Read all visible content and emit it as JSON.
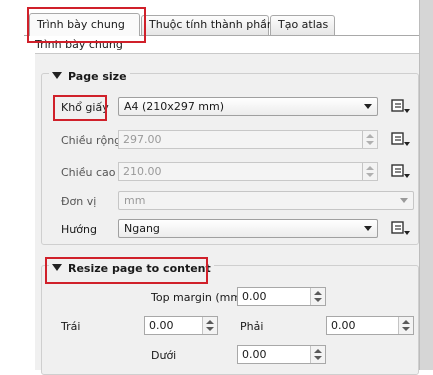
{
  "tabs": [
    {
      "label": "Trình bày chung"
    },
    {
      "label": "Thuộc tính thành phần"
    },
    {
      "label": "Tạo atlas"
    }
  ],
  "panel_title": "Trình bày chung",
  "page_size": {
    "title": "Page size",
    "paper_label": "Khổ giấy",
    "paper_value": "A4 (210x297 mm)",
    "width_label": "Chiều rộng",
    "width_value": "297.00",
    "height_label": "Chiều cao",
    "height_value": "210.00",
    "unit_label": "Đơn vị",
    "unit_value": "mm",
    "orientation_label": "Hướng",
    "orientation_value": "Ngang"
  },
  "resize": {
    "title": "Resize page to content",
    "top_label": "Top margin (mm)",
    "top_value": "0.00",
    "left_label": "Trái",
    "left_value": "0.00",
    "right_label": "Phải",
    "right_value": "0.00",
    "bottom_label": "Dưới",
    "bottom_value": "0.00"
  },
  "colors": {
    "annotation": "#d0202a",
    "panel": "#f0f0f0"
  },
  "icons": {
    "data_defined": "data-defined-override-icon",
    "collapse": "collapse-triangle-icon"
  }
}
